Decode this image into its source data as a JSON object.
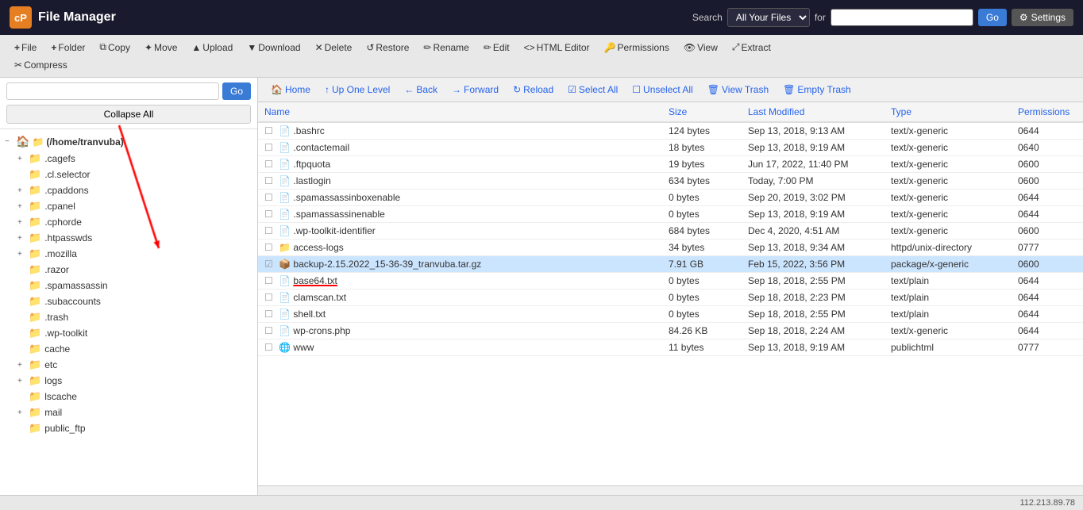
{
  "header": {
    "logo_text": "File Manager",
    "search_label": "Search",
    "search_for_label": "for",
    "search_option": "All Your Files",
    "go_btn": "Go",
    "settings_btn": "Settings"
  },
  "toolbar": {
    "buttons": [
      {
        "id": "new-file",
        "icon": "+",
        "label": "File"
      },
      {
        "id": "new-folder",
        "icon": "+",
        "label": "Folder"
      },
      {
        "id": "copy",
        "icon": "⧉",
        "label": "Copy"
      },
      {
        "id": "move",
        "icon": "+",
        "label": "Move"
      },
      {
        "id": "upload",
        "icon": "▲",
        "label": "Upload"
      },
      {
        "id": "download",
        "icon": "▼",
        "label": "Download"
      },
      {
        "id": "delete",
        "icon": "✕",
        "label": "Delete"
      },
      {
        "id": "restore",
        "icon": "↺",
        "label": "Restore"
      },
      {
        "id": "rename",
        "icon": "✏",
        "label": "Rename"
      },
      {
        "id": "edit",
        "icon": "✏",
        "label": "Edit"
      },
      {
        "id": "html-editor",
        "icon": "<>",
        "label": "HTML Editor"
      },
      {
        "id": "permissions",
        "icon": "🔑",
        "label": "Permissions"
      },
      {
        "id": "view",
        "icon": "👁",
        "label": "View"
      },
      {
        "id": "extract",
        "icon": "⤢",
        "label": "Extract"
      },
      {
        "id": "compress",
        "icon": "✂",
        "label": "Compress"
      }
    ]
  },
  "sidebar": {
    "search_placeholder": "",
    "go_btn": "Go",
    "collapse_btn": "Collapse All",
    "tree": {
      "root_label": "(/home/tranvuba)",
      "items": [
        {
          "id": "cagefs",
          "label": ".cagefs",
          "expanded": false,
          "has_children": true,
          "indent": 1
        },
        {
          "id": "cl-selector",
          "label": ".cl.selector",
          "expanded": false,
          "has_children": false,
          "indent": 1
        },
        {
          "id": "cpaddons",
          "label": ".cpaddons",
          "expanded": false,
          "has_children": true,
          "indent": 1
        },
        {
          "id": "cpanel",
          "label": ".cpanel",
          "expanded": false,
          "has_children": true,
          "indent": 1
        },
        {
          "id": "cphorde",
          "label": ".cphorde",
          "expanded": false,
          "has_children": true,
          "indent": 1
        },
        {
          "id": "htpasswds",
          "label": ".htpasswds",
          "expanded": false,
          "has_children": true,
          "indent": 1
        },
        {
          "id": "mozilla",
          "label": ".mozilla",
          "expanded": false,
          "has_children": true,
          "indent": 1
        },
        {
          "id": "razor",
          "label": ".razor",
          "expanded": false,
          "has_children": false,
          "indent": 1
        },
        {
          "id": "spamassassin",
          "label": ".spamassassin",
          "expanded": false,
          "has_children": false,
          "indent": 1
        },
        {
          "id": "subaccounts",
          "label": ".subaccounts",
          "expanded": false,
          "has_children": false,
          "indent": 1
        },
        {
          "id": "trash",
          "label": ".trash",
          "expanded": false,
          "has_children": false,
          "indent": 1
        },
        {
          "id": "wp-toolkit",
          "label": ".wp-toolkit",
          "expanded": false,
          "has_children": false,
          "indent": 1
        },
        {
          "id": "cache",
          "label": "cache",
          "expanded": false,
          "has_children": false,
          "indent": 1
        },
        {
          "id": "etc",
          "label": "etc",
          "expanded": false,
          "has_children": true,
          "indent": 1
        },
        {
          "id": "logs",
          "label": "logs",
          "expanded": false,
          "has_children": true,
          "indent": 1
        },
        {
          "id": "lscache",
          "label": "lscache",
          "expanded": false,
          "has_children": false,
          "indent": 1
        },
        {
          "id": "mail",
          "label": "mail",
          "expanded": false,
          "has_children": true,
          "indent": 1
        },
        {
          "id": "public_ftp",
          "label": "public_ftp",
          "expanded": false,
          "has_children": false,
          "indent": 1
        }
      ]
    }
  },
  "nav_bar": {
    "home_btn": "Home",
    "up_btn": "Up One Level",
    "back_btn": "Back",
    "forward_btn": "Forward",
    "reload_btn": "Reload",
    "select_all_btn": "Select All",
    "unselect_all_btn": "Unselect All",
    "view_trash_btn": "View Trash",
    "empty_trash_btn": "Empty Trash"
  },
  "file_table": {
    "columns": [
      "Name",
      "Size",
      "Last Modified",
      "Type",
      "Permissions"
    ],
    "rows": [
      {
        "icon": "doc",
        "name": ".bashrc",
        "size": "124 bytes",
        "modified": "Sep 13, 2018, 9:13 AM",
        "type": "text/x-generic",
        "perms": "0644",
        "selected": false
      },
      {
        "icon": "doc",
        "name": ".contactemail",
        "size": "18 bytes",
        "modified": "Sep 13, 2018, 9:19 AM",
        "type": "text/x-generic",
        "perms": "0640",
        "selected": false
      },
      {
        "icon": "doc",
        "name": ".ftpquota",
        "size": "19 bytes",
        "modified": "Jun 17, 2022, 11:40 PM",
        "type": "text/x-generic",
        "perms": "0600",
        "selected": false
      },
      {
        "icon": "doc",
        "name": ".lastlogin",
        "size": "634 bytes",
        "modified": "Today, 7:00 PM",
        "type": "text/x-generic",
        "perms": "0600",
        "selected": false
      },
      {
        "icon": "doc",
        "name": ".spamassassinboxenable",
        "size": "0 bytes",
        "modified": "Sep 20, 2019, 3:02 PM",
        "type": "text/x-generic",
        "perms": "0644",
        "selected": false
      },
      {
        "icon": "doc",
        "name": ".spamassassinenable",
        "size": "0 bytes",
        "modified": "Sep 13, 2018, 9:19 AM",
        "type": "text/x-generic",
        "perms": "0644",
        "selected": false
      },
      {
        "icon": "doc",
        "name": ".wp-toolkit-identifier",
        "size": "684 bytes",
        "modified": "Dec 4, 2020, 4:51 AM",
        "type": "text/x-generic",
        "perms": "0600",
        "selected": false
      },
      {
        "icon": "folder",
        "name": "access-logs",
        "size": "34 bytes",
        "modified": "Sep 13, 2018, 9:34 AM",
        "type": "httpd/unix-directory",
        "perms": "0777",
        "selected": false
      },
      {
        "icon": "pkg",
        "name": "backup-2.15.2022_15-36-39_tranvuba.tar.gz",
        "size": "7.91 GB",
        "modified": "Feb 15, 2022, 3:56 PM",
        "type": "package/x-generic",
        "perms": "0600",
        "selected": true
      },
      {
        "icon": "doc",
        "name": "base64.txt",
        "size": "0 bytes",
        "modified": "Sep 18, 2018, 2:55 PM",
        "type": "text/plain",
        "perms": "0644",
        "selected": false
      },
      {
        "icon": "doc",
        "name": "clamscan.txt",
        "size": "0 bytes",
        "modified": "Sep 18, 2018, 2:23 PM",
        "type": "text/plain",
        "perms": "0644",
        "selected": false
      },
      {
        "icon": "doc",
        "name": "shell.txt",
        "size": "0 bytes",
        "modified": "Sep 18, 2018, 2:55 PM",
        "type": "text/plain",
        "perms": "0644",
        "selected": false
      },
      {
        "icon": "doc",
        "name": "wp-crons.php",
        "size": "84.26 KB",
        "modified": "Sep 18, 2018, 2:24 AM",
        "type": "text/x-generic",
        "perms": "0644",
        "selected": false
      },
      {
        "icon": "globe",
        "name": "www",
        "size": "11 bytes",
        "modified": "Sep 13, 2018, 9:19 AM",
        "type": "publichtml",
        "perms": "0777",
        "selected": false
      }
    ]
  },
  "status_bar": {
    "ip": "112.213.89.78"
  }
}
